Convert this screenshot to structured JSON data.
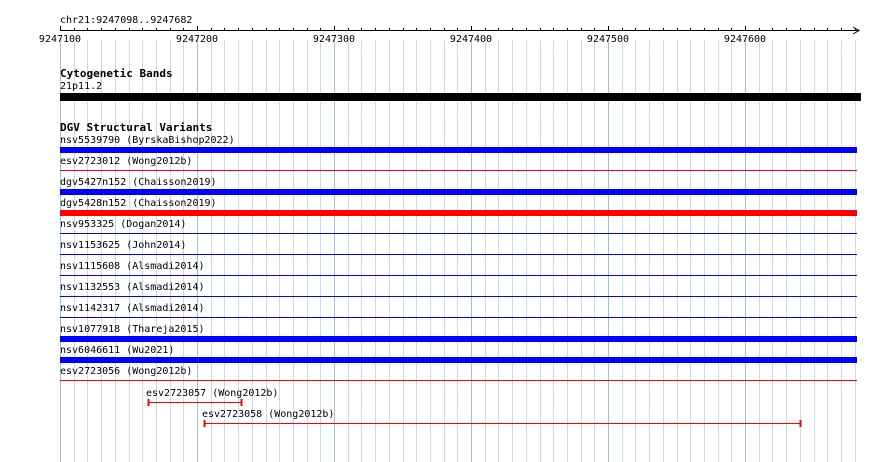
{
  "region_label": "chr21:9247098..9247682",
  "ruler": {
    "ticks": [
      {
        "pos": 9247100,
        "label": "9247100"
      },
      {
        "pos": 9247200,
        "label": "9247200"
      },
      {
        "pos": 9247300,
        "label": "9247300"
      },
      {
        "pos": 9247400,
        "label": "9247400"
      },
      {
        "pos": 9247500,
        "label": "9247500"
      },
      {
        "pos": 9247600,
        "label": "9247600"
      }
    ]
  },
  "colors": {
    "grid": "#c6dcec",
    "gridMajor": "#9ec0da",
    "loss": "#0000ff",
    "gain": "#ff0000",
    "band": "#000000",
    "ruler": "#000000"
  },
  "tracks": {
    "cytoband": {
      "title": "Cytogenetic Bands",
      "band_label": "21p11.2"
    },
    "dgv": {
      "title": "DGV Structural Variants",
      "features": [
        {
          "label": "nsv5539790 (ByrskaBishop2022)",
          "type": "loss",
          "style": "thick",
          "start": 9247098,
          "end": 9247682
        },
        {
          "label": "esv2723012 (Wong2012b)",
          "type": "gain",
          "style": "thin",
          "start": 9247098,
          "end": 9247682
        },
        {
          "label": "dgv5427n152 (Chaisson2019)",
          "type": "loss",
          "style": "thick",
          "start": 9247098,
          "end": 9247682
        },
        {
          "label": "dgv5428n152 (Chaisson2019)",
          "type": "gain",
          "style": "thick",
          "start": 9247098,
          "end": 9247682
        },
        {
          "label": "nsv953325 (Dogan2014)",
          "type": "loss",
          "style": "thin",
          "start": 9247098,
          "end": 9247682
        },
        {
          "label": "nsv1153625 (John2014)",
          "type": "loss",
          "style": "thin",
          "start": 9247098,
          "end": 9247682
        },
        {
          "label": "nsv1115608 (Alsmadi2014)",
          "type": "loss",
          "style": "thin",
          "start": 9247098,
          "end": 9247682
        },
        {
          "label": "nsv1132553 (Alsmadi2014)",
          "type": "loss",
          "style": "thin",
          "start": 9247098,
          "end": 9247682
        },
        {
          "label": "nsv1142317 (Alsmadi2014)",
          "type": "loss",
          "style": "thin",
          "start": 9247098,
          "end": 9247682
        },
        {
          "label": "nsv1077918 (Thareja2015)",
          "type": "loss",
          "style": "thick",
          "start": 9247098,
          "end": 9247682
        },
        {
          "label": "nsv6046611 (Wu2021)",
          "type": "loss",
          "style": "thick",
          "start": 9247098,
          "end": 9247682
        },
        {
          "label": "esv2723056 (Wong2012b)",
          "type": "gain",
          "style": "thin",
          "start": 9247098,
          "end": 9247682
        },
        {
          "label": "esv2723057 (Wong2012b)",
          "type": "gain",
          "style": "span",
          "start": 9247164,
          "end": 9247232
        },
        {
          "label": "esv2723058 (Wong2012b)",
          "type": "gain",
          "style": "span",
          "start": 9247205,
          "end": 9247640
        }
      ]
    }
  }
}
